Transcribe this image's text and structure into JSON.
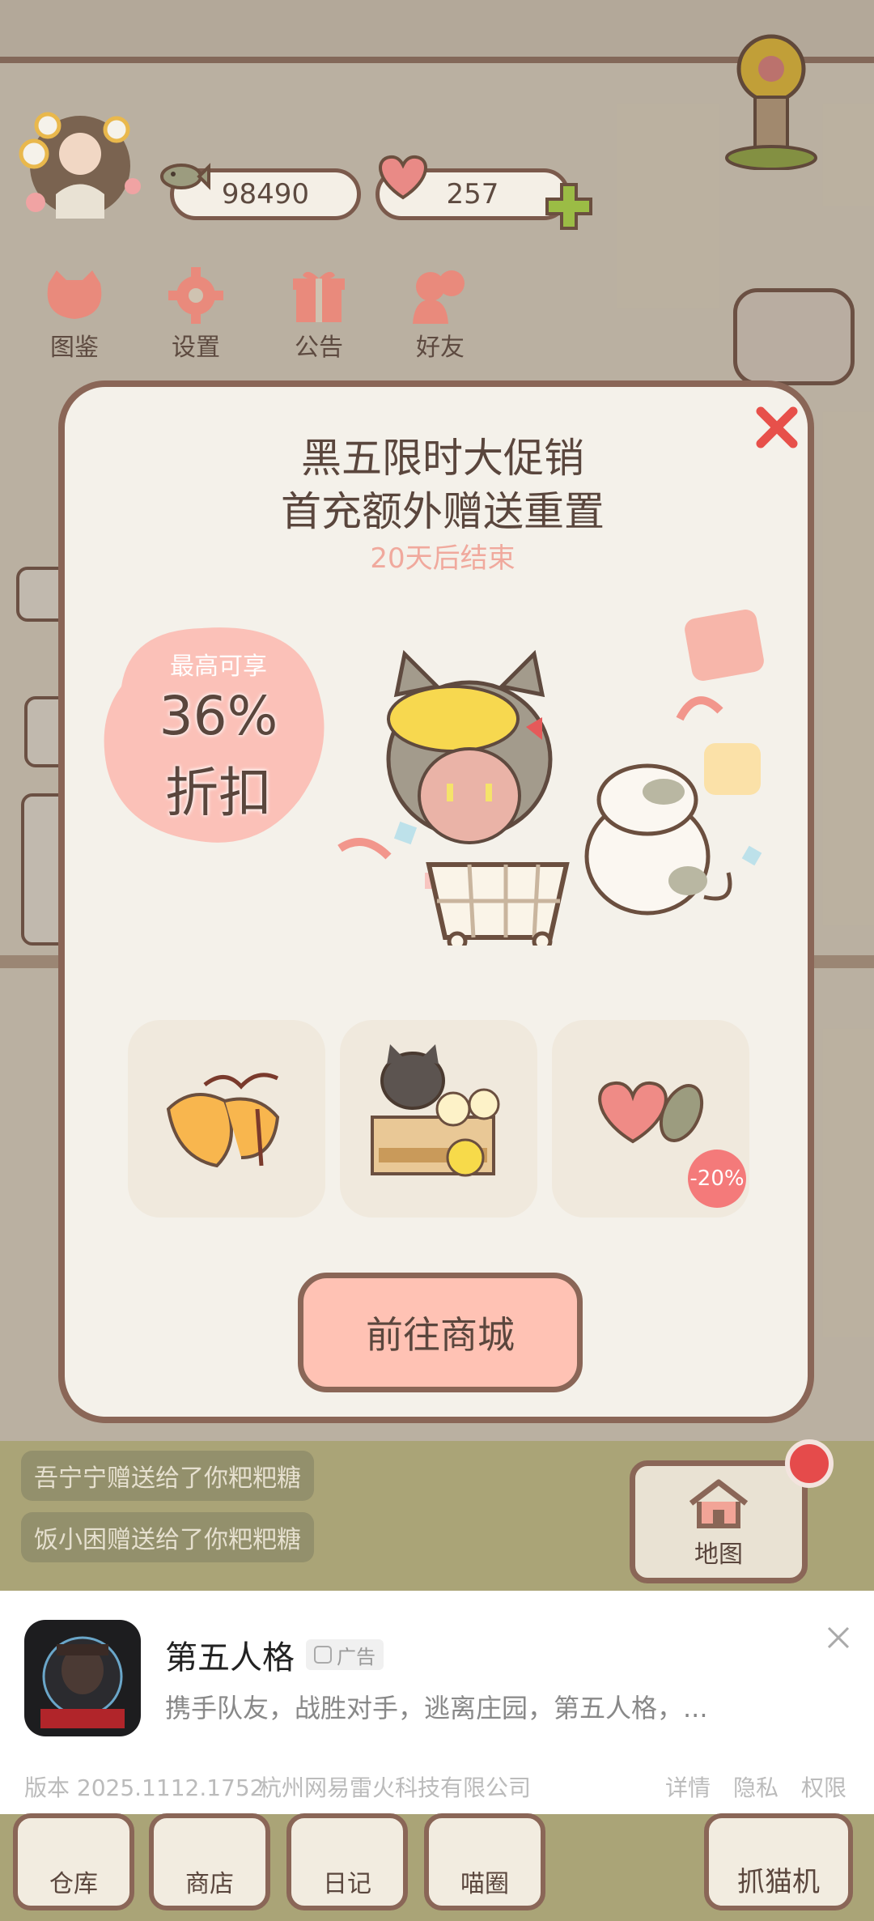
{
  "hud": {
    "coins": "98490",
    "hearts": "257",
    "buttons": [
      {
        "label": "图鉴",
        "icon": "cat-book-icon"
      },
      {
        "label": "设置",
        "icon": "gear-icon"
      },
      {
        "label": "公告",
        "icon": "gift-icon"
      },
      {
        "label": "好友",
        "icon": "friends-icon"
      }
    ]
  },
  "promo": {
    "title_line1": "黑五限时大促销",
    "title_line2": "首充额外赠送重置",
    "countdown": "20天后结束",
    "badge_top": "最高可享",
    "badge_value": "36%",
    "badge_bottom": "折扣",
    "item3_discount": "-20%",
    "cta_label": "前往商城",
    "close_icon": "close-x-icon"
  },
  "feed": {
    "messages": [
      "吾宁宁赠送给了你粑粑糖",
      "饭小困赠送给了你粑粑糖"
    ]
  },
  "map_button": {
    "label": "地图"
  },
  "ad": {
    "app_name": "第五人格",
    "badge": "广告",
    "description": "携手队友，战胜对手，逃离庄园，第五人格，...",
    "version": "版本 2025.1112.1752",
    "company": "杭州网易雷火科技有限公司",
    "links": [
      "详情",
      "隐私",
      "权限"
    ]
  },
  "bottom_nav": {
    "items": [
      "仓库",
      "商店",
      "日记",
      "喵圈",
      "抓猫机"
    ]
  },
  "colors": {
    "modal_bg": "#f4f1ea",
    "border_brown": "#8a6657",
    "accent_pink": "#ffc2b4",
    "close_red": "#e7504a"
  }
}
